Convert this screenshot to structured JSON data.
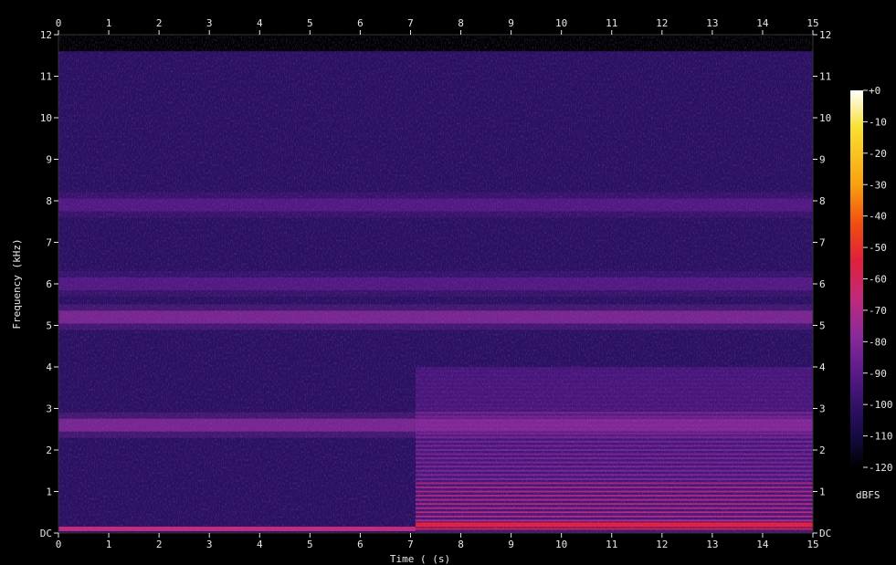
{
  "chart_data": {
    "type": "heatmap",
    "xlabel": "Time ( (s)",
    "ylabel": "Frequency (kHz)",
    "xlim": [
      0,
      15
    ],
    "ylim": [
      0,
      12
    ],
    "x_ticks": [
      "0",
      "1",
      "2",
      "3",
      "4",
      "5",
      "6",
      "7",
      "8",
      "9",
      "10",
      "11",
      "12",
      "13",
      "14",
      "15"
    ],
    "y_ticks": [
      "DC",
      "1",
      "2",
      "3",
      "4",
      "5",
      "6",
      "7",
      "8",
      "9",
      "10",
      "11",
      "12"
    ],
    "colorbar": {
      "label": "dBFS",
      "range": [
        -120,
        0
      ],
      "ticks": [
        "+0",
        "-10",
        "-20",
        "-30",
        "-40",
        "-50",
        "-60",
        "-70",
        "-80",
        "-90",
        "-100",
        "-110",
        "-120"
      ],
      "colormap": [
        "#000000",
        "#120a3a",
        "#2a1060",
        "#5a1a88",
        "#8a2a9a",
        "#c02a7a",
        "#e0203a",
        "#f05010",
        "#f8a010",
        "#f8e030",
        "#ffffff"
      ]
    },
    "segment_split_s": 7.1,
    "noise_floor_dbfs": -100,
    "upper_cutoff_khz": 11.6,
    "bands": [
      {
        "freq_khz": 0.1,
        "dbfs": -55,
        "t_start": 0,
        "t_end": 7.1
      },
      {
        "freq_khz": 0.2,
        "dbfs": -45,
        "t_start": 7.1,
        "t_end": 15
      },
      {
        "freq_khz": 2.6,
        "dbfs": -68,
        "t_start": 0,
        "t_end": 15
      },
      {
        "freq_khz": 5.2,
        "dbfs": -78,
        "t_start": 0,
        "t_end": 15
      },
      {
        "freq_khz": 6.0,
        "dbfs": -82,
        "t_start": 0,
        "t_end": 15
      },
      {
        "freq_khz": 7.9,
        "dbfs": -86,
        "t_start": 0,
        "t_end": 15
      }
    ],
    "harmonic_region": {
      "t_start": 7.1,
      "t_end": 15,
      "f_low_khz": 0,
      "f_high_khz": 4.0,
      "dbfs": -80
    }
  }
}
